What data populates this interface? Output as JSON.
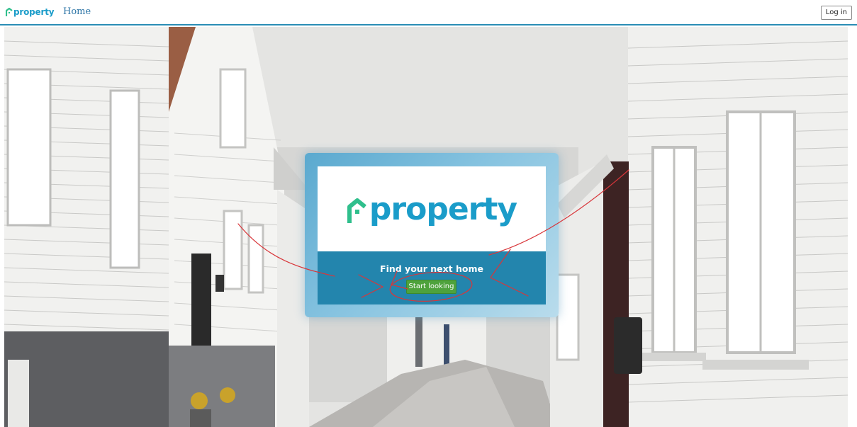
{
  "navbar": {
    "brand": "property",
    "home_label": "Home",
    "login_label": "Log in"
  },
  "hero": {
    "logo_text": "property",
    "tagline": "Find your next home",
    "cta_label": "Start looking"
  },
  "colors": {
    "brand_blue": "#1a9cc9",
    "logo_green": "#2fbf8c",
    "cta_panel": "#2385ad",
    "cta_button": "#4ea23c",
    "nav_border": "#2a8db5",
    "annotation": "#d8363a"
  },
  "icons": {
    "brand": "house-roof-icon",
    "annotation": "red-hand-drawn-arrows"
  }
}
